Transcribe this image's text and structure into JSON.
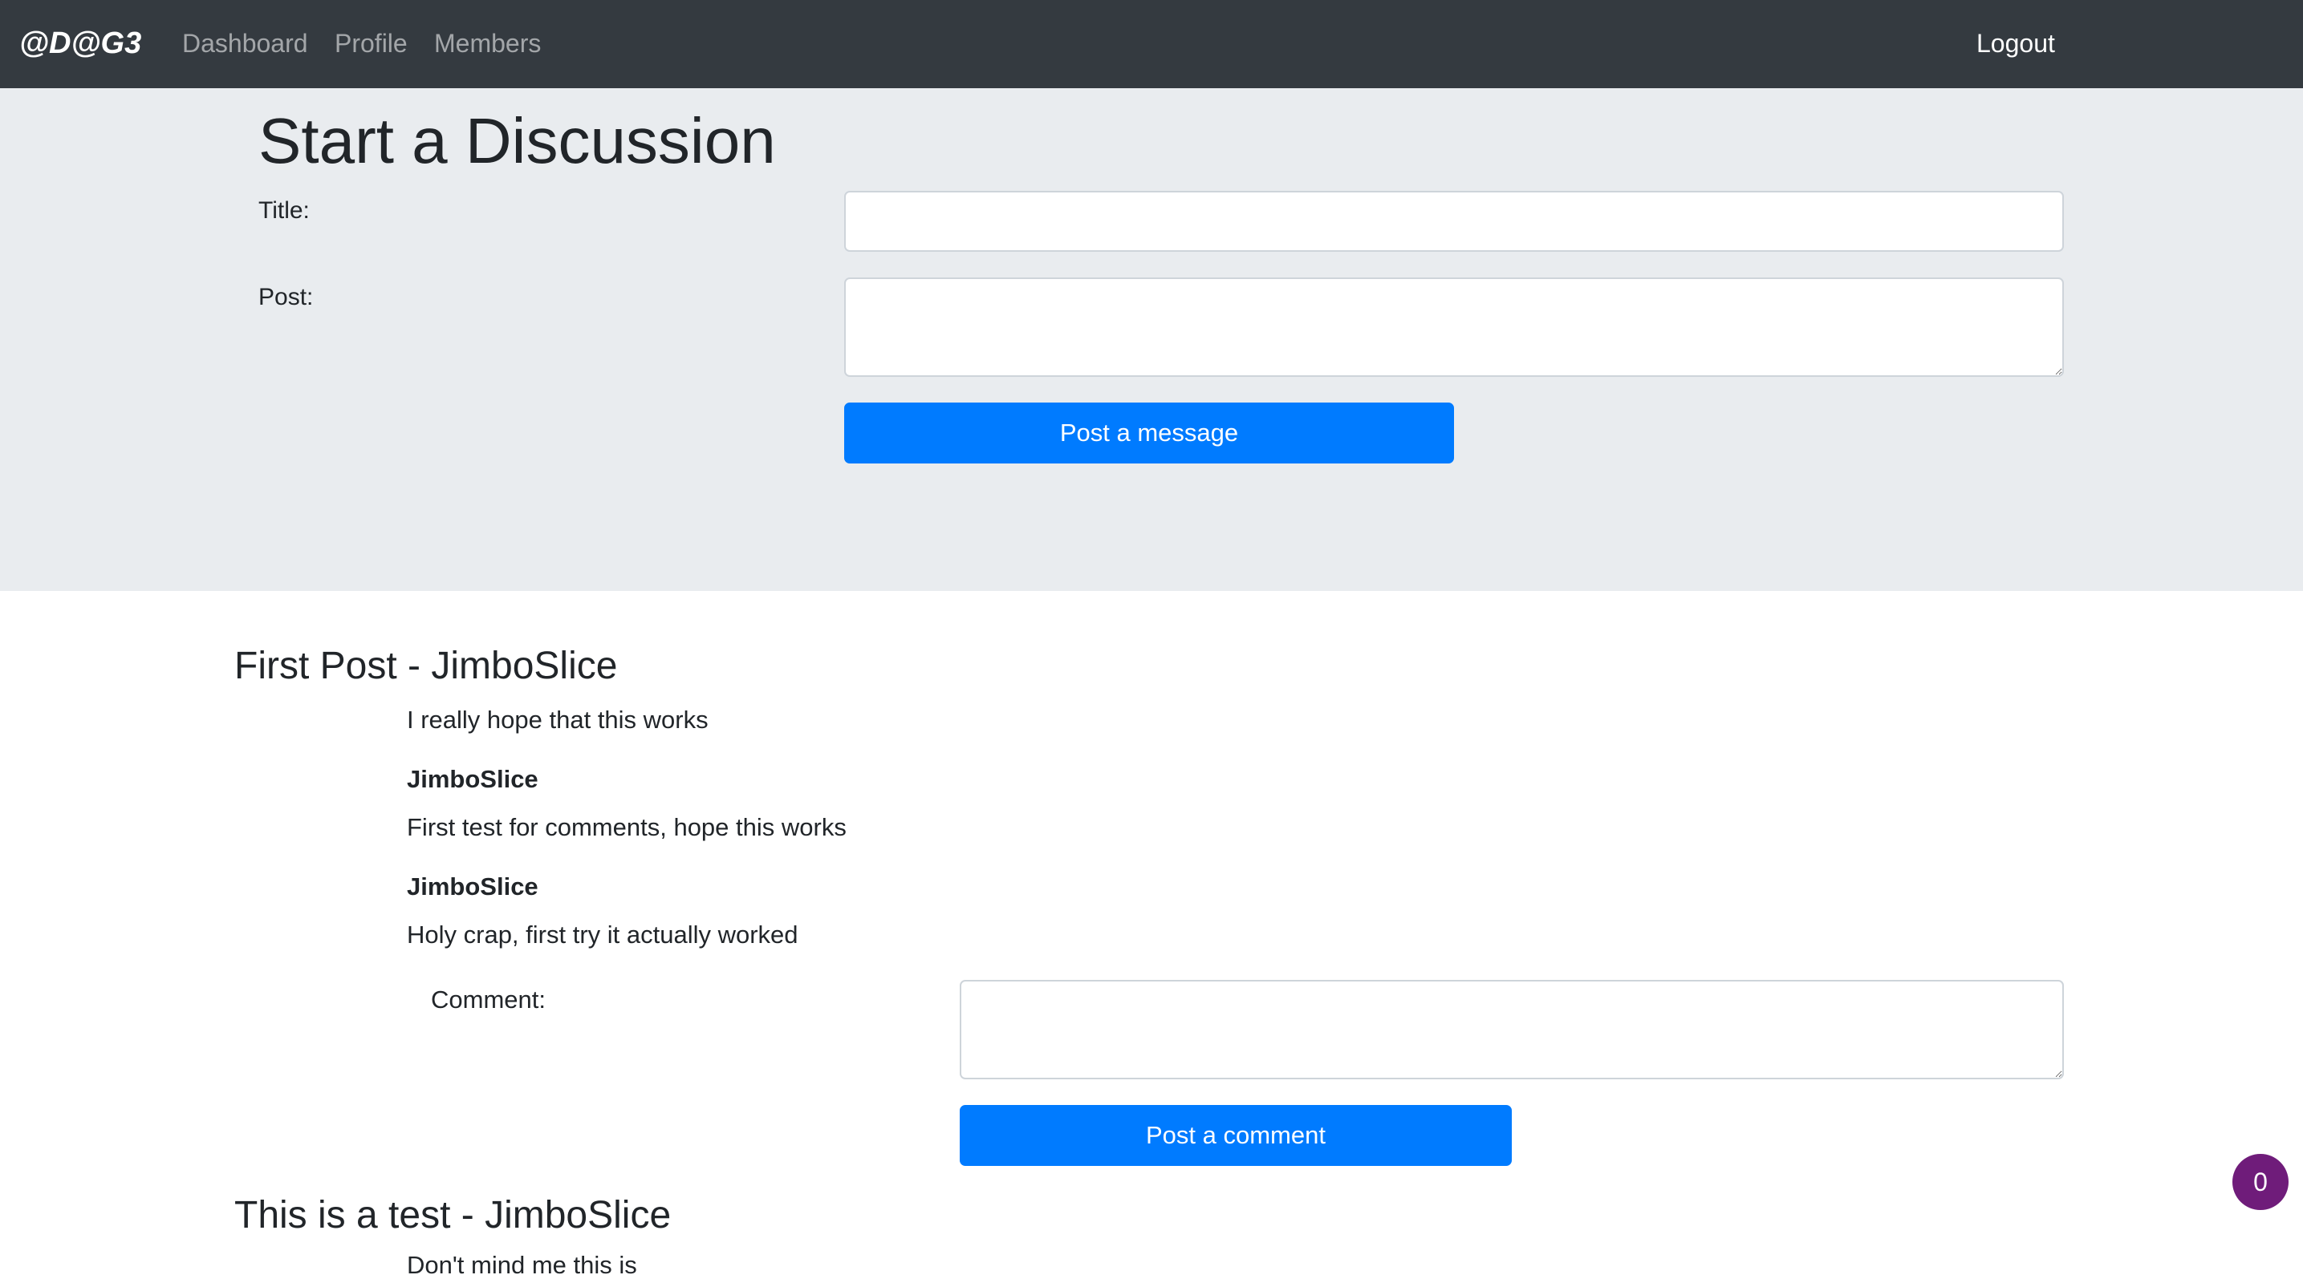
{
  "nav": {
    "brand": "@D@G3",
    "links": [
      "Dashboard",
      "Profile",
      "Members"
    ],
    "logout": "Logout"
  },
  "discussion_form": {
    "heading": "Start a Discussion",
    "title_label": "Title:",
    "title_value": "",
    "post_label": "Post:",
    "post_value": "",
    "submit_label": "Post a message"
  },
  "posts": [
    {
      "heading": "First Post - JimboSlice",
      "body": "I really hope that this works",
      "comments": [
        {
          "author": "JimboSlice",
          "text": "First test for comments, hope this works"
        },
        {
          "author": "JimboSlice",
          "text": "Holy crap, first try it actually worked"
        }
      ],
      "comment_label": "Comment:",
      "comment_value": "",
      "comment_button": "Post a comment"
    },
    {
      "heading": "This is a test - JimboSlice",
      "body": "Don't mind me this is"
    }
  ],
  "notification_count": "0",
  "colors": {
    "navbar": "#343a40",
    "jumbotron": "#e9ecef",
    "primary": "#007bff",
    "badge": "#6f1c7a"
  }
}
